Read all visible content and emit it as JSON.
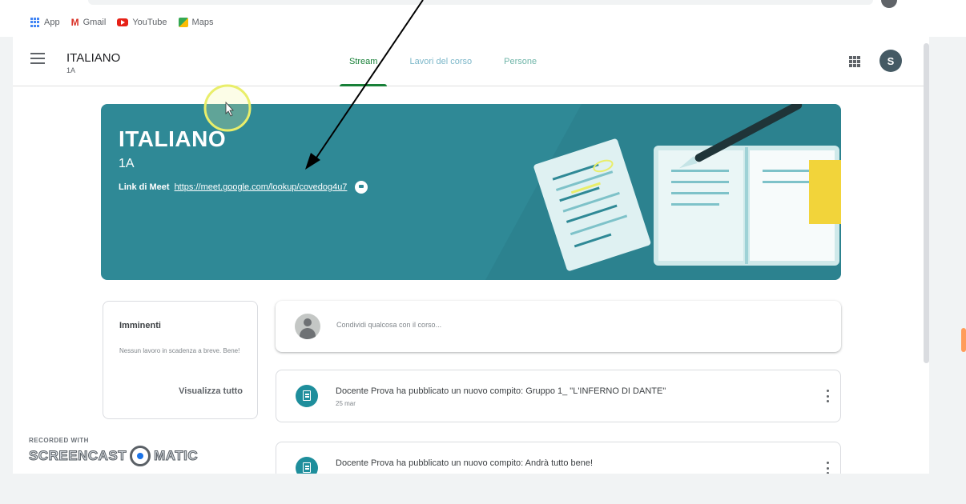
{
  "browser": {
    "bookmarks": [
      {
        "label": "App",
        "icon": "apps-grid-icon"
      },
      {
        "label": "Gmail",
        "icon": "gmail-icon"
      },
      {
        "label": "YouTube",
        "icon": "youtube-icon"
      },
      {
        "label": "Maps",
        "icon": "maps-icon"
      }
    ]
  },
  "header": {
    "title": "ITALIANO",
    "subtitle": "1A",
    "tabs": [
      {
        "label": "Stream",
        "active": true
      },
      {
        "label": "Lavori del corso",
        "active": false
      },
      {
        "label": "Persone",
        "active": false
      }
    ],
    "avatar_letter": "S"
  },
  "banner": {
    "title": "ITALIANO",
    "subtitle": "1A",
    "meet_label": "Link di Meet",
    "meet_url": "https://meet.google.com/lookup/covedog4u7",
    "color": "#2f8996"
  },
  "upcoming": {
    "title": "Imminenti",
    "text": "Nessun lavoro in scadenza a breve. Bene!",
    "link": "Visualizza tutto"
  },
  "share": {
    "placeholder": "Condividi qualcosa con il corso..."
  },
  "posts": [
    {
      "title": "Docente Prova ha pubblicato un nuovo compito: Gruppo 1_ \"L'INFERNO DI DANTE\"",
      "date": "25 mar"
    },
    {
      "title": "Docente Prova ha pubblicato un nuovo compito: Andrà tutto bene!",
      "date": ""
    }
  ],
  "watermark": {
    "top": "RECORDED WITH",
    "left": "SCREENCAST",
    "right": "MATIC"
  },
  "colors": {
    "accent": "#188038",
    "banner": "#2f8996",
    "assignment_icon": "#1e8e9c",
    "annotation_circle": "#e9ee6a"
  }
}
